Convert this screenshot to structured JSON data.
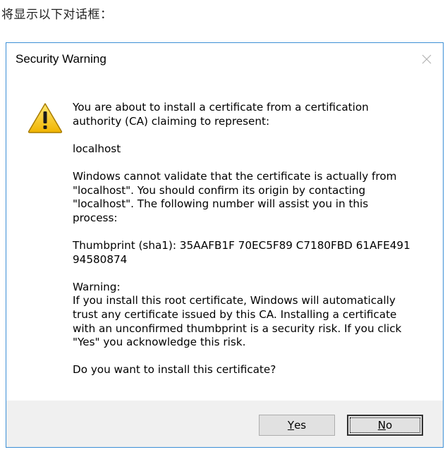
{
  "caption": "将显示以下对话框：",
  "dialog": {
    "title": "Security Warning",
    "icon": "warning-icon",
    "close_icon": "close-icon",
    "paragraphs": [
      "You are about to install a certificate from a certification\nauthority (CA) claiming to represent:",
      "localhost",
      "Windows cannot validate that the certificate is actually from\n\"localhost\". You should confirm its origin by contacting\n\"localhost\". The following number will assist you in this\nprocess:",
      "Thumbprint (sha1): 35AAFB1F 70EC5F89 C7180FBD 61AFE491\n94580874",
      "Warning:\nIf you install this root certificate, Windows will automatically\ntrust any certificate issued by this CA. Installing a certificate\nwith an unconfirmed thumbprint is a security risk. If you click\n\"Yes\" you acknowledge this risk.",
      "Do you want to install this certificate?"
    ],
    "buttons": {
      "yes": {
        "mnemonic": "Y",
        "rest": "es"
      },
      "no": {
        "mnemonic": "N",
        "rest": "o"
      }
    },
    "colors": {
      "border": "#3c8fd6",
      "footer": "#f0f0f0",
      "warning_yellow": "#f2c811"
    }
  }
}
